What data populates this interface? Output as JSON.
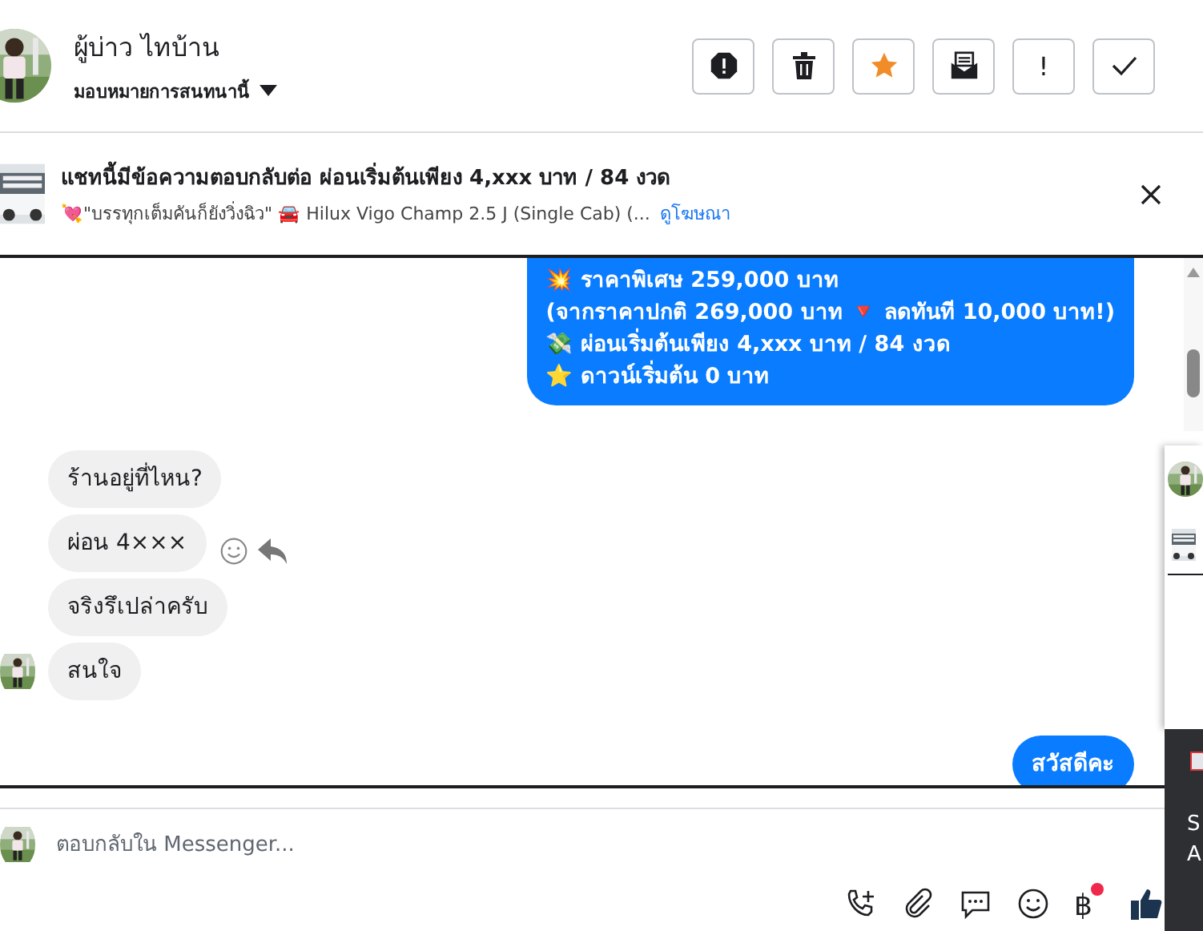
{
  "header": {
    "name": "ผู้บ่าว ไทบ้าน",
    "assign": "มอบหมายการสนทนานี้",
    "actions": [
      {
        "kind": "report"
      },
      {
        "kind": "trash"
      },
      {
        "kind": "star"
      },
      {
        "kind": "mail"
      },
      {
        "kind": "text",
        "label": "!"
      },
      {
        "kind": "done"
      }
    ]
  },
  "banner": {
    "title": "แชทนี้มีข้อความตอบกลับต่อ ผ่อนเริ่มต้นเพียง 4,xxx บาท / 84 งวด",
    "subtitle": "💘\"บรรทุกเต็มคันก็ยังวิ่งฉิว\" 🚘 Hilux Vigo Champ 2.5 J (Single Cab) (...",
    "link": "ดูโฆษณา"
  },
  "messages": [
    {
      "kind": "sent",
      "lines": [
        "💥 ราคาพิเศษ 259,000 บาท",
        "(จากราคาปกติ 269,000 บาท 🔻 ลดทันที 10,000 บาท!)",
        "💸 ผ่อนเริ่มต้นเพียง 4,xxx บาท / 84 งวด",
        "⭐ ดาวน์เริ่มต้น 0 บาท"
      ]
    },
    {
      "kind": "received",
      "lines": [
        "ร้านอยู่ที่ไหน?"
      ]
    },
    {
      "kind": "received",
      "lines": [
        "ผ่อน 4×××"
      ],
      "actions": true
    },
    {
      "kind": "received",
      "lines": [
        "จริงรึเปล่าครับ"
      ]
    },
    {
      "kind": "received",
      "lines": [
        "สนใจ"
      ],
      "avatar": true
    },
    {
      "kind": "sent",
      "lines": [
        "สวัสดีคะ"
      ]
    }
  ],
  "composer": {
    "placeholder": "ตอบกลับใน Messenger...",
    "tools": [
      {
        "kind": "call"
      },
      {
        "kind": "attach"
      },
      {
        "kind": "chat"
      },
      {
        "kind": "emoji"
      },
      {
        "kind": "text",
        "label": "฿",
        "badge": true
      },
      {
        "kind": "like"
      }
    ]
  },
  "side_panel": {
    "texts": [
      "S",
      "A"
    ]
  }
}
